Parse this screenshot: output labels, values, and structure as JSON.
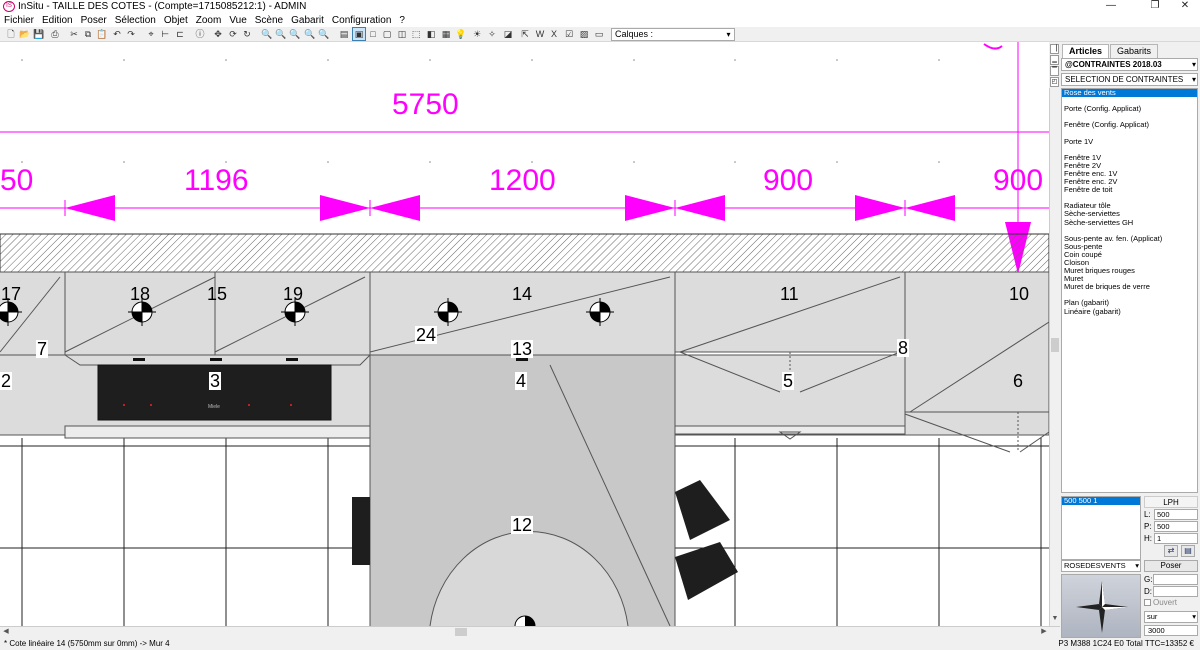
{
  "window": {
    "title": "InSitu - TAILLE DES COTES - (Compte=1715085212:1) - ADMIN",
    "controls": [
      "—",
      "❐",
      "✕"
    ]
  },
  "menu": [
    "Fichier",
    "Edition",
    "Poser",
    "Sélection",
    "Objet",
    "Zoom",
    "Vue",
    "Scène",
    "Gabarit",
    "Configuration",
    "?"
  ],
  "toolbar": {
    "layers_label": "Calques :"
  },
  "canvas": {
    "total_dimension": "5750",
    "dimensions": [
      "50",
      "1196",
      "1200",
      "900",
      "900"
    ],
    "labels": [
      "17",
      "18",
      "15",
      "19",
      "14",
      "11",
      "10",
      "7",
      "24",
      "13",
      "8",
      "2",
      "3",
      "4",
      "5",
      "6",
      "12"
    ],
    "hob_brand": "Miele"
  },
  "sidepanel": {
    "tabs": [
      "Articles",
      "Gabarits"
    ],
    "catalog": "@CONTRAINTES 2018.03",
    "category": "SELECTION DE CONTRAINTES",
    "items": [
      "Rose des vents",
      "",
      "Porte (Config. Applicat)",
      "",
      "Fenêtre (Config. Applicat)",
      "",
      "Porte 1V",
      "",
      "Fenêtre 1V",
      "Fenêtre 2V",
      "Fenêtre enc. 1V",
      "Fenêtre enc. 2V",
      "Fenêtre de toit",
      "",
      "Radiateur tôle",
      "Sèche-serviettes",
      "Sèche-serviettes GH",
      "",
      "Sous-pente av. fen. (Applicat)",
      "Sous-pente",
      "Coin coupé",
      "Cloison",
      "Muret briques rouges",
      "Muret",
      "Muret de briques de verre",
      "",
      "Plan (gabarit)",
      "Linéaire (gabarit)"
    ],
    "selected_item": "Rose des vents",
    "size_row": "500  500    1",
    "lph_label": "LPH",
    "fields": [
      {
        "label": "L:",
        "value": "500"
      },
      {
        "label": "P:",
        "value": "500"
      },
      {
        "label": "H:",
        "value": "1"
      }
    ],
    "object_select": "ROSEDESVENTS",
    "poser_label": "Poser",
    "g_label": "G:",
    "d_label": "D:",
    "ouvert_label": "Ouvert",
    "sur_select": "sur",
    "value_field": "3000"
  },
  "status": {
    "left": "* Cote linéaire 14  (5750mm sur 0mm) -> Mur 4",
    "right": "P3 M388 1C24 E0 Total TTC=13352 €"
  },
  "colors": {
    "dimension": "#ff00ff",
    "selection": "#0078d7",
    "counter": "#dcdcdc",
    "hob": "#1e1e1e"
  }
}
